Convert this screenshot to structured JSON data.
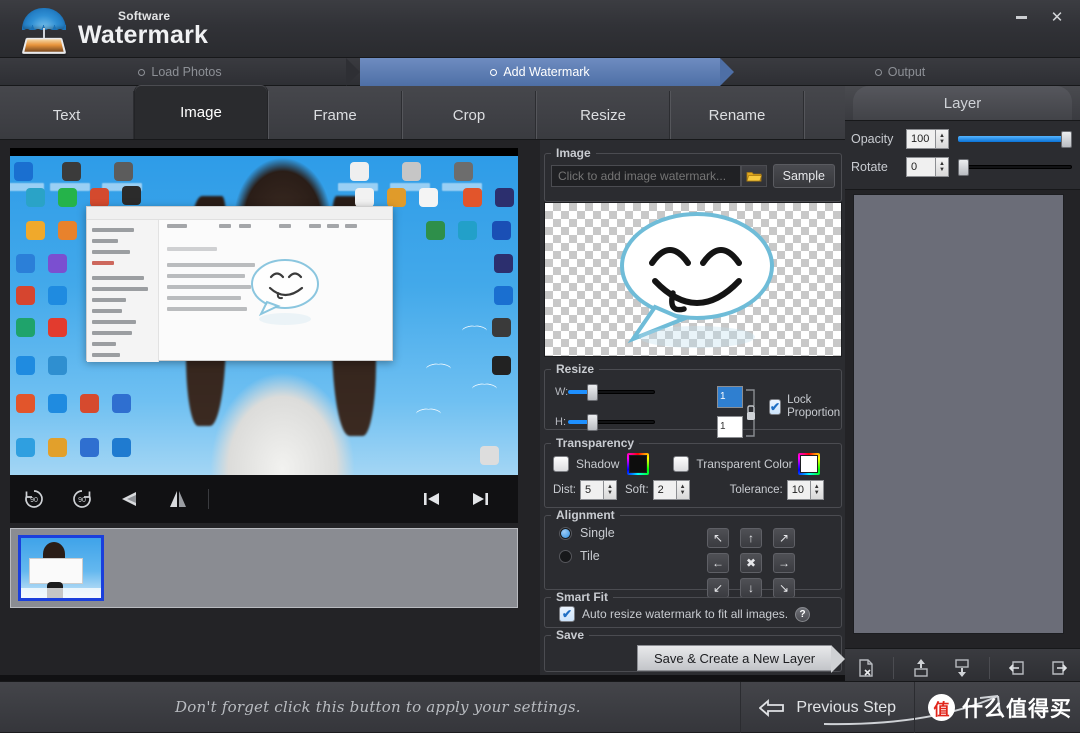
{
  "window": {
    "title_sub": "Software",
    "title_main": "Watermark",
    "logo_icon": "umbrella-photo-logo",
    "minimize_label": "Minimize",
    "close_label": "✕"
  },
  "steps": [
    {
      "label": "Load Photos",
      "active": false
    },
    {
      "label": "Add Watermark",
      "active": true
    },
    {
      "label": "Output",
      "active": false
    }
  ],
  "tabs": [
    {
      "label": "Text",
      "active": false
    },
    {
      "label": "Image",
      "active": true
    },
    {
      "label": "Frame",
      "active": false
    },
    {
      "label": "Crop",
      "active": false
    },
    {
      "label": "Resize",
      "active": false
    },
    {
      "label": "Rename",
      "active": false
    }
  ],
  "preview": {
    "toolbar": [
      {
        "name": "rotate-left-90",
        "glyph": "90"
      },
      {
        "name": "rotate-right-90",
        "glyph": "90"
      },
      {
        "name": "flip-horizontal",
        "glyph": "◀"
      },
      {
        "name": "flip-vertical",
        "glyph": "◢◣"
      },
      {
        "name": "previous-image",
        "glyph": "|◀"
      },
      {
        "name": "next-image",
        "glyph": "▶|"
      }
    ]
  },
  "image_group": {
    "legend": "Image",
    "path_placeholder": "Click to add image watermark...",
    "path_value": "",
    "browse_icon": "folder-open-icon",
    "sample_label": "Sample"
  },
  "resize_group": {
    "legend": "Resize",
    "width_label": "W:",
    "width_value": "1",
    "height_label": "H:",
    "height_value": "1",
    "link_icon": "chain-link-icon",
    "lock_label": "Lock Proportion",
    "lock_checked": true
  },
  "transparency_group": {
    "legend": "Transparency",
    "shadow_label": "Shadow",
    "shadow_checked": false,
    "shadow_color": "#0d0d0d",
    "transparent_color_label": "Transparent Color",
    "transparent_color_checked": false,
    "transparent_color": "#ffffff",
    "dist_label": "Dist:",
    "dist_value": "5",
    "soft_label": "Soft:",
    "soft_value": "2",
    "tolerance_label": "Tolerance:",
    "tolerance_value": "10"
  },
  "alignment_group": {
    "legend": "Alignment",
    "single_label": "Single",
    "tile_label": "Tile",
    "mode_selected": "Single",
    "buttons": [
      {
        "name": "align-top-left",
        "glyph": "↖"
      },
      {
        "name": "align-top-center",
        "glyph": "↑"
      },
      {
        "name": "align-top-right",
        "glyph": "↗"
      },
      {
        "name": "align-middle-left",
        "glyph": "←"
      },
      {
        "name": "align-center",
        "glyph": "✖"
      },
      {
        "name": "align-middle-right",
        "glyph": "→"
      },
      {
        "name": "align-bottom-left",
        "glyph": "↙"
      },
      {
        "name": "align-bottom-center",
        "glyph": "↓"
      },
      {
        "name": "align-bottom-right",
        "glyph": "↘"
      }
    ]
  },
  "smartfit_group": {
    "legend": "Smart Fit",
    "auto_resize_label": "Auto resize watermark to fit all images.",
    "auto_resize_checked": true,
    "help_glyph": "?"
  },
  "save_group": {
    "legend": "Save",
    "button_label": "Save & Create a New Layer"
  },
  "layer_panel": {
    "title": "Layer",
    "opacity_label": "Opacity",
    "opacity_value": "100",
    "opacity_percent": 100,
    "rotate_label": "Rotate",
    "rotate_value": "0",
    "rotate_percent": 2,
    "tools": [
      {
        "name": "delete-layer-icon",
        "glyph": "🗋"
      },
      {
        "name": "move-layer-up-icon",
        "glyph": "⬆"
      },
      {
        "name": "move-layer-down-icon",
        "glyph": "⬇"
      },
      {
        "name": "import-layer-icon",
        "glyph": "⬅"
      },
      {
        "name": "export-layer-icon",
        "glyph": "➡"
      }
    ]
  },
  "bottom_bar": {
    "hint": "Don't forget click this button to apply your settings.",
    "previous_step_label": "Previous Step",
    "previous_step_icon": "arrow-left-icon",
    "watermark_logo_char": "值",
    "watermark_text": "什么值得买"
  },
  "colors": {
    "accent_blue": "#1e90ff",
    "step_active": "#4e6fa6",
    "panel_bg": "#2b2c30",
    "titlebar_bg": "#313237",
    "thumb_selected_border": "#1a3fdc"
  }
}
